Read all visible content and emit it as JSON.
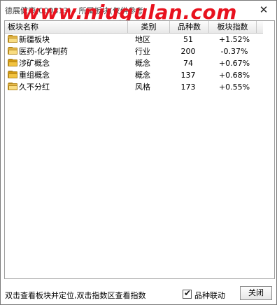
{
  "window": {
    "title": "德展健康(000813) - 所属板块(仅供参考)",
    "watermark": "www.niugulan.com",
    "close_glyph": "✕"
  },
  "table": {
    "columns": [
      "板块名称",
      "类别",
      "品种数",
      "板块指数"
    ],
    "rows": [
      {
        "name": "新疆板块",
        "category": "地区",
        "count": "51",
        "index": "+1.52%",
        "icon": "folder-icon"
      },
      {
        "name": "医药-化学制药",
        "category": "行业",
        "count": "200",
        "index": "-0.37%",
        "icon": "folder-icon"
      },
      {
        "name": "涉矿概念",
        "category": "概念",
        "count": "74",
        "index": "+0.67%",
        "icon": "folder-icon"
      },
      {
        "name": "重组概念",
        "category": "概念",
        "count": "137",
        "index": "+0.68%",
        "icon": "folder-icon"
      },
      {
        "name": "久不分红",
        "category": "风格",
        "count": "173",
        "index": "+0.55%",
        "icon": "folder-icon"
      }
    ]
  },
  "status": {
    "hint": "双击查看板块并定位,双击指数区查看指数",
    "checkbox_label": "品种联动",
    "checkbox_checked": true,
    "close_button": "关闭"
  },
  "colors": {
    "watermark": "#e8121e",
    "folder": "#e6b84a"
  }
}
